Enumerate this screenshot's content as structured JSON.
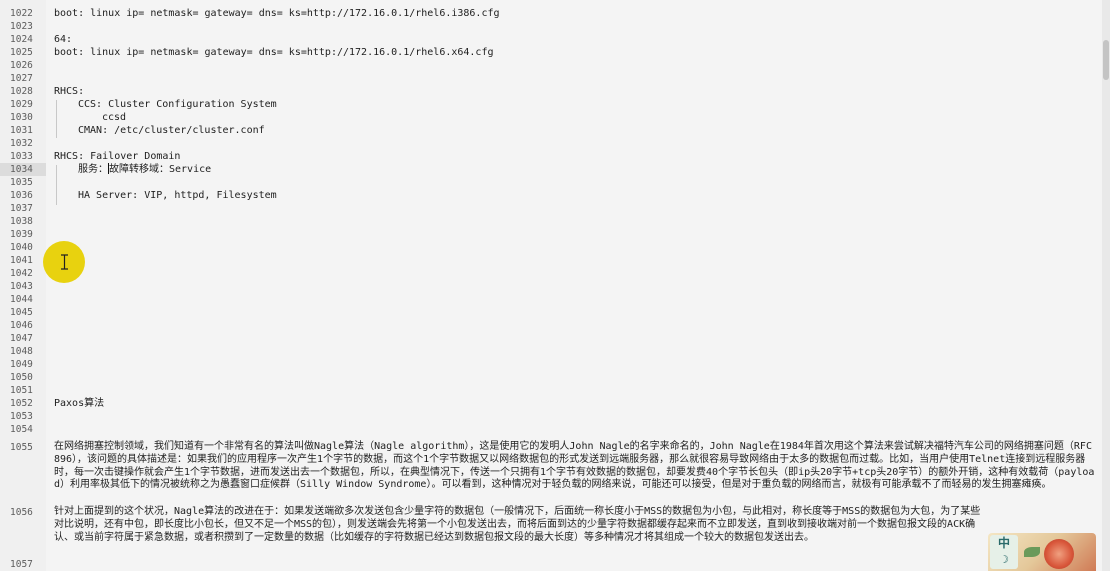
{
  "editor": {
    "lines": [
      {
        "n": "1022",
        "indent": 0,
        "text": "boot: linux ip= netmask= gateway= dns= ks=http://172.16.0.1/rhel6.i386.cfg"
      },
      {
        "n": "1023",
        "indent": 0,
        "text": ""
      },
      {
        "n": "1024",
        "indent": 0,
        "text": "64:"
      },
      {
        "n": "1025",
        "indent": 0,
        "text": "boot: linux ip= netmask= gateway= dns= ks=http://172.16.0.1/rhel6.x64.cfg"
      },
      {
        "n": "1026",
        "indent": 0,
        "text": ""
      },
      {
        "n": "1027",
        "indent": 0,
        "text": ""
      },
      {
        "n": "1028",
        "indent": 0,
        "text": "RHCS:"
      },
      {
        "n": "1029",
        "indent": 1,
        "text": "CCS: Cluster Configuration System"
      },
      {
        "n": "1030",
        "indent": 2,
        "text": "ccsd"
      },
      {
        "n": "1031",
        "indent": 1,
        "text": "CMAN: /etc/cluster/cluster.conf"
      },
      {
        "n": "1032",
        "indent": 0,
        "text": ""
      },
      {
        "n": "1033",
        "indent": 0,
        "text": "RHCS: Failover Domain"
      },
      {
        "n": "1034",
        "indent": 1,
        "text": "服务：故障转移域：Service"
      },
      {
        "n": "1035",
        "indent": 0,
        "text": ""
      },
      {
        "n": "1036",
        "indent": 1,
        "text": "HA Server: VIP, httpd, Filesystem"
      },
      {
        "n": "1037",
        "indent": 0,
        "text": ""
      },
      {
        "n": "1038",
        "indent": 0,
        "text": ""
      },
      {
        "n": "1039",
        "indent": 0,
        "text": ""
      },
      {
        "n": "1040",
        "indent": 0,
        "text": ""
      },
      {
        "n": "1041",
        "indent": 0,
        "text": ""
      },
      {
        "n": "1042",
        "indent": 0,
        "text": ""
      },
      {
        "n": "1043",
        "indent": 0,
        "text": ""
      },
      {
        "n": "1044",
        "indent": 0,
        "text": ""
      },
      {
        "n": "1045",
        "indent": 0,
        "text": ""
      },
      {
        "n": "1046",
        "indent": 0,
        "text": ""
      },
      {
        "n": "1047",
        "indent": 0,
        "text": ""
      },
      {
        "n": "1048",
        "indent": 0,
        "text": ""
      },
      {
        "n": "1049",
        "indent": 0,
        "text": ""
      },
      {
        "n": "1050",
        "indent": 0,
        "text": ""
      },
      {
        "n": "1051",
        "indent": 0,
        "text": ""
      },
      {
        "n": "1052",
        "indent": 0,
        "text": "Paxos算法"
      },
      {
        "n": "1053",
        "indent": 0,
        "text": ""
      },
      {
        "n": "1054",
        "indent": 0,
        "text": ""
      }
    ],
    "current_line": "1034",
    "caret_after": "服务：",
    "caret_before": "故障转移域：Service",
    "para_1055_number": "1055",
    "para_1055_text": "在网络拥塞控制领域，我们知道有一个非常有名的算法叫做Nagle算法（Nagle algorithm），这是使用它的发明人John Nagle的名字来命名的，John Nagle在1984年首次用这个算法来尝试解决福特汽车公司的网络拥塞问题（RFC 896），该问题的具体描述是：如果我们的应用程序一次产生1个字节的数据，而这个1个字节数据又以网络数据包的形式发送到远端服务器，那么就很容易导致网络由于太多的数据包而过载。比如，当用户使用Telnet连接到远程服务器时，每一次击键操作就会产生1个字节数据，进而发送出去一个数据包，所以，在典型情况下，传送一个只拥有1个字节有效数据的数据包，却要发费40个字节长包头（即ip头20字节+tcp头20字节）的额外开销，这种有效载荷（payload）利用率极其低下的情况被统称之为愚蠢窗口症候群（Silly Window Syndrome）。可以看到，这种情况对于轻负载的网络来说，可能还可以接受，但是对于重负载的网络而言，就极有可能承载不了而轻易的发生拥塞瘫痪。",
    "para_1056_number": "1056",
    "para_1056_text": "针对上面提到的这个状况，Nagle算法的改进在于：如果发送端欲多次发送包含少量字符的数据包（一般情况下，后面统一称长度小于MSS的数据包为小包，与此相对，称长度等于MSS的数据包为大包，为了某些对比说明，还有中包，即长度比小包长，但又不足一个MSS的包），则发送端会先将第一个小包发送出去，而将后面到达的少量字符数据都缓存起来而不立即发送，直到收到接收端对前一个数据包报文段的ACK确认、或当前字符属于紧急数据，或者积攒到了一定数量的数据（比如缓存的字符数据已经达到数据包报文段的最大长度）等多种情况才将其组成一个较大的数据包发送出去。",
    "line_1057": "1057"
  },
  "ime": {
    "logo_text": "中",
    "icon": "ime-flower-icon"
  },
  "colors": {
    "background": "#f4f4f4",
    "line_number": "#5c5c5c",
    "current_line_highlight": "#dcdcdc",
    "mouse_highlight": "#e8d20f"
  }
}
